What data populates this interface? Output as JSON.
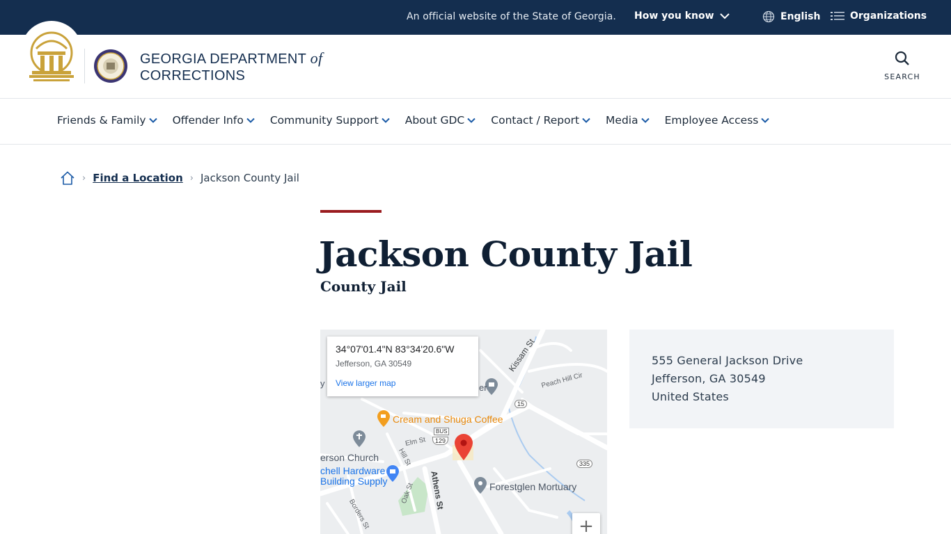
{
  "topbar": {
    "official_text": "An official website of the State of Georgia.",
    "how_you_know": "How you know",
    "language": "English",
    "organizations": "Organizations",
    "background_color": "#142e4f"
  },
  "header": {
    "brand_line1": "GEORGIA DEPARTMENT",
    "brand_of": "of",
    "brand_line2": "CORRECTIONS",
    "search_label": "SEARCH"
  },
  "nav": {
    "items": [
      {
        "label": "Friends & Family"
      },
      {
        "label": "Offender Info"
      },
      {
        "label": "Community Support"
      },
      {
        "label": "About GDC"
      },
      {
        "label": "Contact / Report"
      },
      {
        "label": "Media"
      },
      {
        "label": "Employee Access"
      }
    ]
  },
  "breadcrumb": {
    "home_icon": "home-icon",
    "link": "Find a Location",
    "current": "Jackson County Jail"
  },
  "page": {
    "title": "Jackson County Jail",
    "subtitle": "County Jail",
    "accent_color": "#9a1c1f"
  },
  "map": {
    "coords": "34°07'01.4\"N 83°34'20.6\"W",
    "place": "Jefferson, GA 30549",
    "view_larger": "View larger map",
    "labels": {
      "coffee": "Cream and Shuga Coffee",
      "church": "erson Church",
      "hardware1": "chell Hardware",
      "hardware2": "Building Supply",
      "mortuary": "Forestglen Mortuary",
      "kissam": "Kissam St",
      "peachhill": "Peach Hill Cir",
      "elm": "Elm St",
      "hill": "Hill St",
      "athens": "Athens St",
      "oak": "Oak St",
      "borders": "Borders St",
      "route15": "15",
      "route335": "335",
      "route129": "129",
      "bus": "BUS",
      "er": "er",
      "y": "y"
    },
    "zoom_in": "+"
  },
  "address": {
    "line1": "555 General Jackson Drive",
    "line2": "Jefferson, GA 30549",
    "line3": "United States"
  }
}
